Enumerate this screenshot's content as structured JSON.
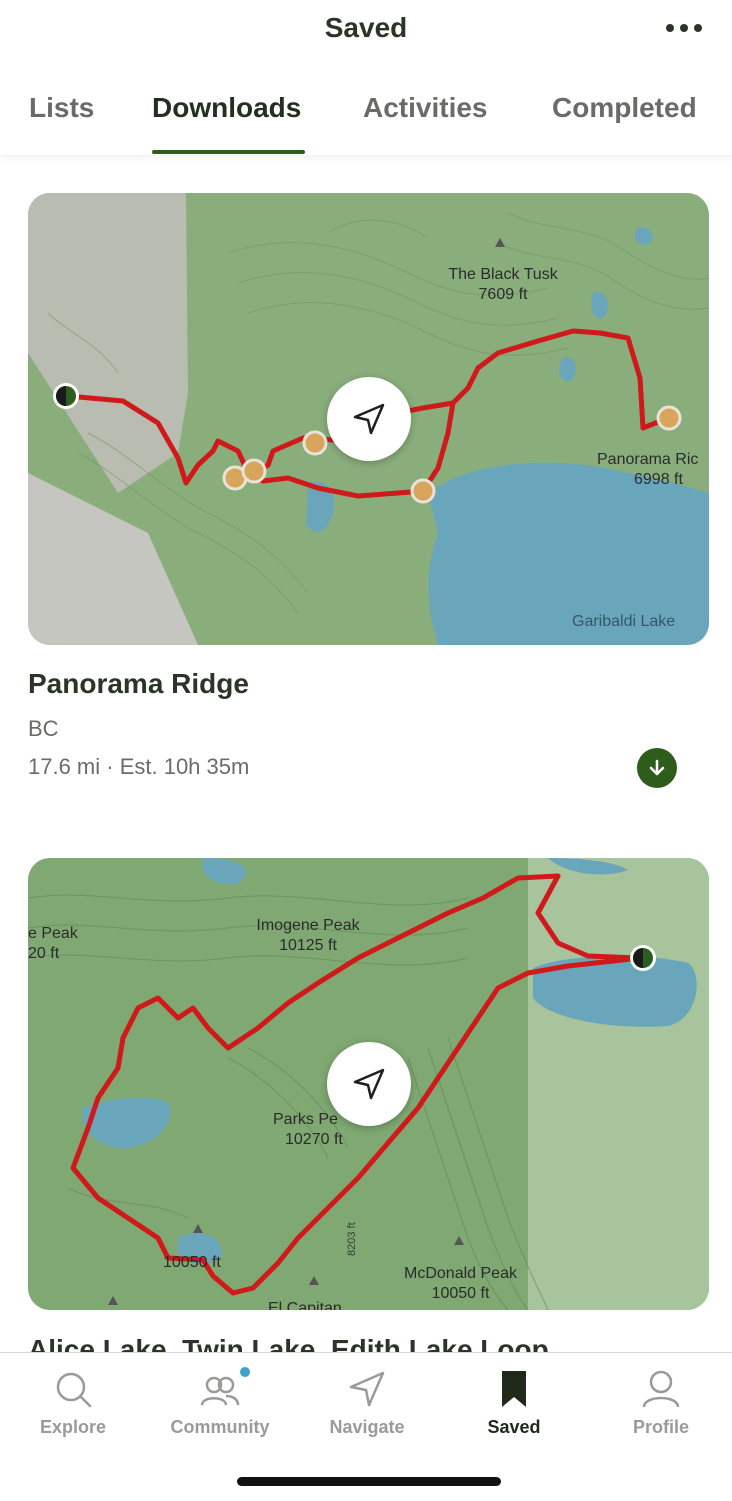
{
  "header": {
    "title": "Saved",
    "more_icon": "more-horizontal-icon",
    "tabs": [
      {
        "label": "Lists"
      },
      {
        "label": "Downloads"
      },
      {
        "label": "Activities"
      },
      {
        "label": "Completed"
      }
    ],
    "active_tab": "Downloads"
  },
  "cards": [
    {
      "name": "Panorama Ridge",
      "region": "BC",
      "meta": "17.6 mi · Est. 10h 35m",
      "download_icon": "download-icon",
      "map_labels": {
        "peak1_name": "The Black Tusk",
        "peak1_elev": "7609 ft",
        "peak2_name": "Panorama Ric",
        "peak2_elev": "6998 ft",
        "lake": "Garibaldi Lake"
      }
    },
    {
      "name": "Alice Lake, Twin Lake, Edith Lake Loop",
      "map_labels": {
        "peak_left_name": "e Peak",
        "peak_left_elev": "20 ft",
        "peak1_name": "Imogene Peak",
        "peak1_elev": "10125 ft",
        "peak2_name": "Parks Pe",
        "peak2_elev": "10270 ft",
        "peak3_elev": "10050 ft",
        "peak4_name": "McDonald Peak",
        "peak4_elev": "10050 ft",
        "contour": "8203 ft",
        "bottom_label": "El Capitan"
      }
    }
  ],
  "tabbar": {
    "items": [
      {
        "label": "Explore",
        "icon": "search-icon"
      },
      {
        "label": "Community",
        "icon": "community-icon"
      },
      {
        "label": "Navigate",
        "icon": "navigate-icon"
      },
      {
        "label": "Saved",
        "icon": "bookmark-icon"
      },
      {
        "label": "Profile",
        "icon": "profile-icon"
      }
    ],
    "active": "Saved"
  },
  "colors": {
    "brand_green": "#2e5d1b",
    "trail_red": "#d0191b",
    "map_green": "#86ad78",
    "lake_blue": "#6aa6bb",
    "waypoint_tan": "#d9a45c"
  }
}
